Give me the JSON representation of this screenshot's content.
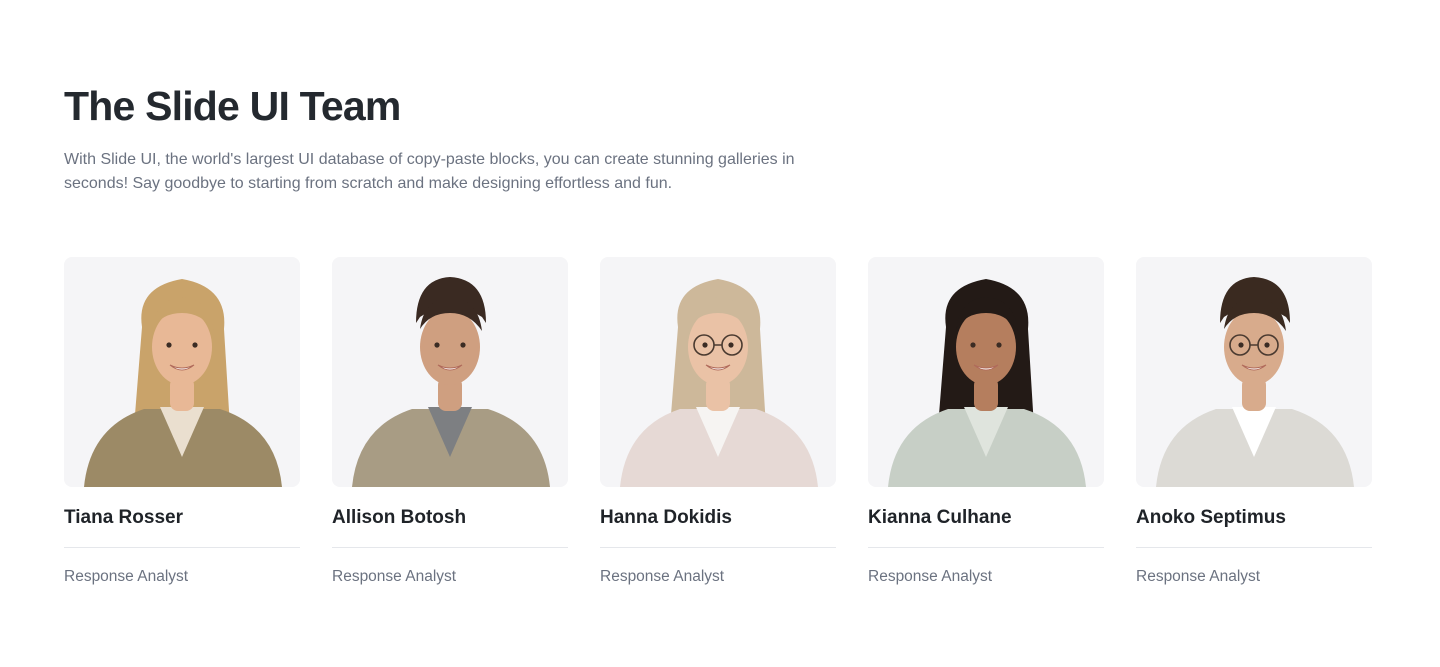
{
  "header": {
    "title": "The Slide UI Team",
    "description": "With Slide UI, the world's largest UI database of copy-paste blocks, you can create stunning galleries in seconds! Say goodbye to starting from scratch and make designing effortless and fun."
  },
  "team": [
    {
      "name": "Tiana Rosser",
      "role": "Response Analyst",
      "hair": "#c9a36a",
      "skin": "#e8b896",
      "top": "#9c8a66",
      "shirt": "#eadfcf",
      "glasses": false,
      "long_hair": true
    },
    {
      "name": "Allison Botosh",
      "role": "Response Analyst",
      "hair": "#3a2a22",
      "skin": "#cf9f80",
      "top": "#a89c84",
      "shirt": "#7d7f82",
      "glasses": false,
      "long_hair": false
    },
    {
      "name": "Hanna Dokidis",
      "role": "Response Analyst",
      "hair": "#cdb89a",
      "skin": "#eac2a6",
      "top": "#e6d9d5",
      "shirt": "#f6f4f2",
      "glasses": true,
      "long_hair": true
    },
    {
      "name": "Kianna Culhane",
      "role": "Response Analyst",
      "hair": "#231a16",
      "skin": "#b57e5e",
      "top": "#c7cfc6",
      "shirt": "#dfe4dd",
      "glasses": false,
      "long_hair": true
    },
    {
      "name": "Anoko Septimus",
      "role": "Response Analyst",
      "hair": "#3a2a20",
      "skin": "#d8ab8c",
      "top": "#dcdad5",
      "shirt": "#ffffff",
      "glasses": true,
      "long_hair": false
    }
  ],
  "colors": {
    "card_background": "#f5f5f7",
    "divider": "#e5e7eb",
    "muted_text": "#6b7280"
  }
}
